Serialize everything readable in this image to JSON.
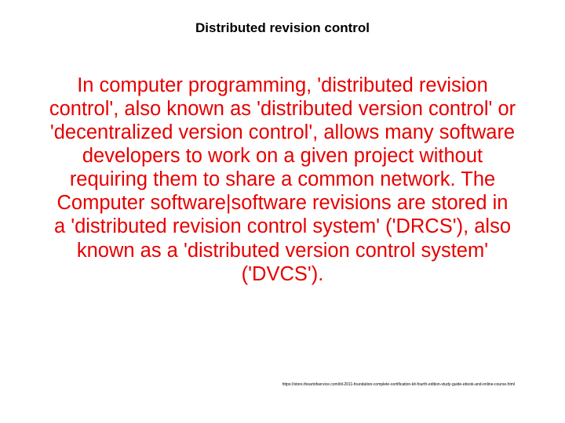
{
  "slide": {
    "title": "Distributed revision control",
    "body": "In computer programming, 'distributed revision control', also known as 'distributed version control' or 'decentralized version control', allows many software developers to work on a given project without requiring them to share a common network.  The Computer software|software revisions are stored in a 'distributed revision control system' ('DRCS'), also known as a 'distributed version control system' ('DVCS').",
    "footer_url": "https://store.theartofservice.com/itil-2011-foundation-complete-certification-kit-fourth-edition-study-guide-ebook-and-online-course.html"
  }
}
